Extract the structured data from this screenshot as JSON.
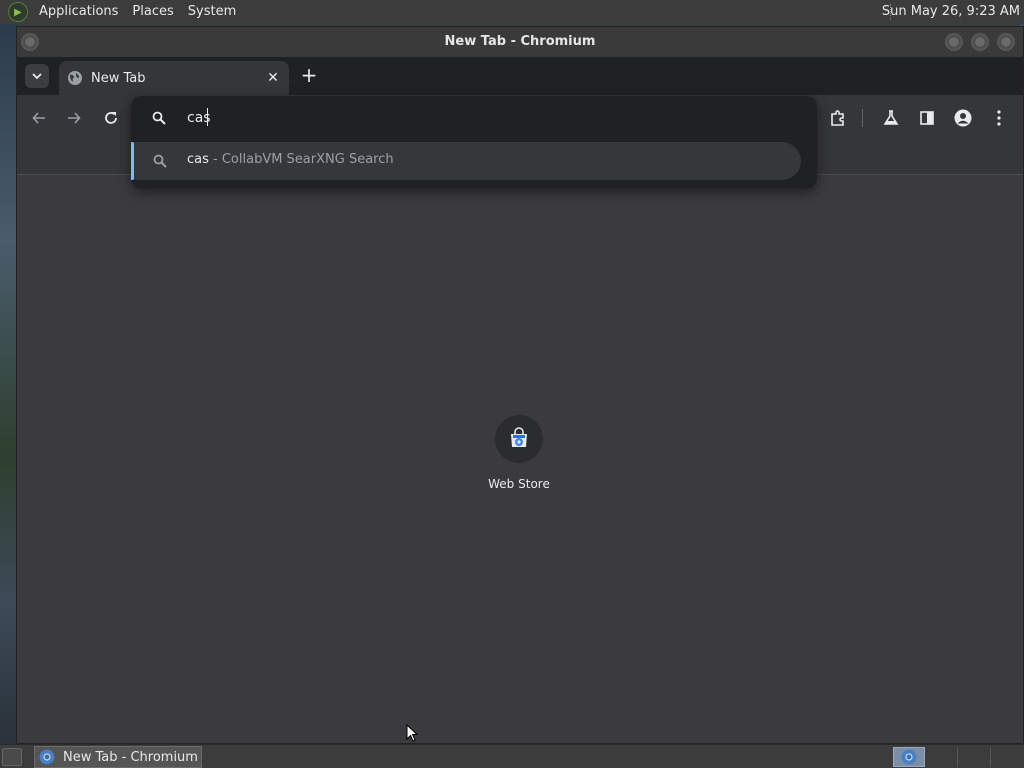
{
  "top_panel": {
    "menus": [
      "Applications",
      "Places",
      "System"
    ],
    "clock": "Sun May 26,  9:23 AM"
  },
  "window": {
    "title": "New Tab - Chromium"
  },
  "tabs": [
    {
      "label": "New Tab",
      "active": true
    }
  ],
  "omnibox": {
    "input_value": "cas",
    "suggestions": [
      {
        "query": "cas",
        "description": " - CollabVM SearXNG Search"
      }
    ]
  },
  "content": {
    "shortcuts": [
      {
        "label": "Web Store"
      }
    ]
  },
  "taskbar": {
    "items": [
      {
        "label": "New Tab - Chromium"
      }
    ]
  },
  "colors": {
    "accent": "#8ab4f8",
    "background": "#3b3b3f",
    "toolbar": "#35363a",
    "omnibox_bg": "#202124"
  }
}
